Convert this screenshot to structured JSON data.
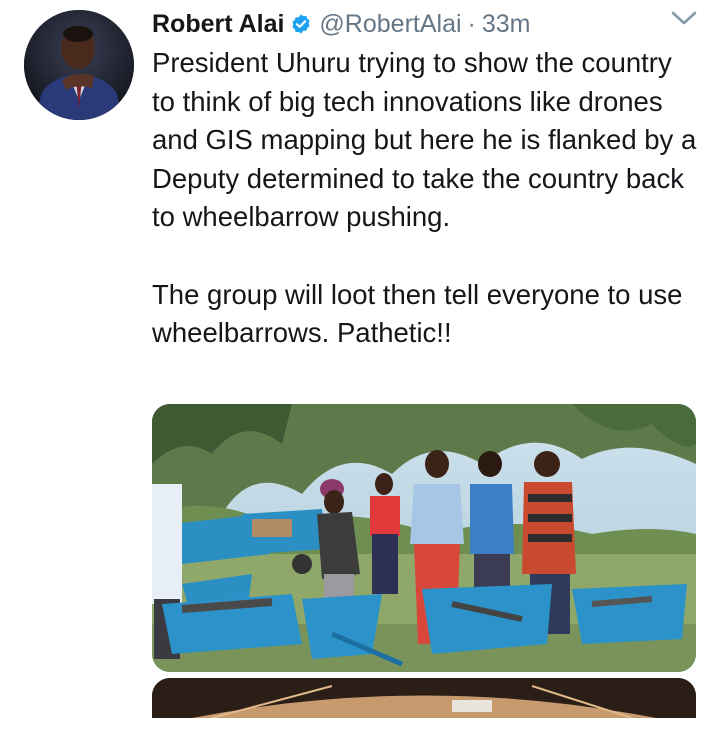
{
  "tweet": {
    "author_name": "Robert Alai",
    "handle": "@RobertAlai",
    "separator": "·",
    "time": "33m",
    "paragraphs": [
      "President Uhuru trying to show the country to think of big tech innovations like drones and GIS mapping but here he is flanked by a Deputy determined to take the country back to wheelbarrow pushing.",
      "The group will loot then tell everyone to use wheelbarrows. Pathetic!!"
    ]
  },
  "icons": {
    "verified": "verified-badge-icon",
    "menu": "chevron-down-icon"
  },
  "colors": {
    "text": "#14171a",
    "secondary": "#657786",
    "verified": "#1da1f2"
  }
}
